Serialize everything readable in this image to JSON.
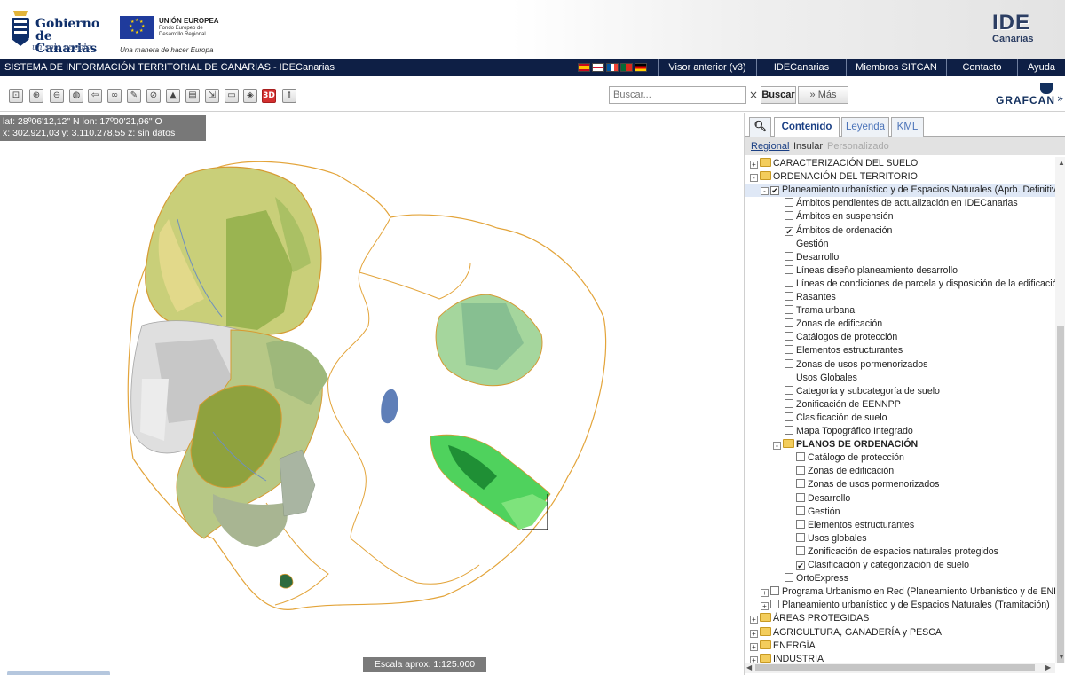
{
  "header": {
    "gobierno_name": "Gobierno de Canarias",
    "gobierno_slogan": "un solo pueblo",
    "eu_title": "UNIÓN EUROPEA",
    "eu_fund": "Fondo Europeo de Desarrollo Regional",
    "eu_motto": "Una manera de hacer Europa",
    "ide_logo": "IDE",
    "ide_logo_sub": "Canarias"
  },
  "navbar": {
    "title": "SISTEMA DE INFORMACIÓN TERRITORIAL DE CANARIAS - IDECanarias",
    "flags": [
      "es",
      "gb",
      "fr",
      "pt",
      "de"
    ],
    "links": [
      "Visor anterior (v3)",
      "IDECanarias",
      "Miembros SITCAN",
      "Contacto",
      "Ayuda"
    ]
  },
  "toolbar": {
    "tools": [
      "zoom-extent-icon",
      "zoom-in-icon",
      "zoom-out-icon",
      "globe-icon",
      "back-icon",
      "link-icon",
      "draw-icon",
      "measure-icon",
      "profile-icon",
      "print-icon",
      "export-icon",
      "swipe-icon",
      "layers-icon",
      "3d-icon",
      "info-icon"
    ],
    "label_3d": "3D",
    "search_placeholder": "Buscar...",
    "search_button": "Buscar",
    "more_button": "» Más",
    "grafcan": "GRAFCAN",
    "panel_toggle": "»"
  },
  "map": {
    "coords_line1": "lat: 28º06'12,12\" N  lon: 17º00'21,96\" O",
    "coords_line2": "x: 302.921,03  y: 3.110.278,55  z: sin datos",
    "scale": "Escala aprox. 1:125.000"
  },
  "panel": {
    "search_tab": "search-icon",
    "tabs": [
      "Contenido",
      "Leyenda",
      "KML"
    ],
    "subtabs": [
      "Regional",
      "Insular",
      "Personalizado"
    ],
    "tree": [
      {
        "label": "CARACTERIZACIÓN DEL SUELO",
        "level": 0,
        "expander": "+",
        "folder": true
      },
      {
        "label": "ORDENACIÓN DEL TERRITORIO",
        "level": 0,
        "expander": "-",
        "folder": true
      },
      {
        "label": "Planeamiento urbanístico y de Espacios Naturales (Aprb. Definitiva)",
        "level": 1,
        "expander": "-",
        "checked": true,
        "highlight": true
      },
      {
        "label": "Ámbitos pendientes de actualización en IDECanarias",
        "level": 2
      },
      {
        "label": "Ámbitos en suspensión",
        "level": 2
      },
      {
        "label": "Ámbitos de ordenación",
        "level": 2,
        "checked": true
      },
      {
        "label": "Gestión",
        "level": 2
      },
      {
        "label": "Desarrollo",
        "level": 2
      },
      {
        "label": "Líneas diseño planeamiento desarrollo",
        "level": 2
      },
      {
        "label": "Líneas de condiciones de parcela y disposición de la edificación",
        "level": 2
      },
      {
        "label": "Rasantes",
        "level": 2
      },
      {
        "label": "Trama urbana",
        "level": 2
      },
      {
        "label": "Zonas de edificación",
        "level": 2
      },
      {
        "label": "Catálogos de protección",
        "level": 2
      },
      {
        "label": "Elementos estructurantes",
        "level": 2
      },
      {
        "label": "Zonas de usos pormenorizados",
        "level": 2
      },
      {
        "label": "Usos Globales",
        "level": 2
      },
      {
        "label": "Categoría y subcategoría de suelo",
        "level": 2
      },
      {
        "label": "Zonificación de EENNPP",
        "level": 2
      },
      {
        "label": "Clasificación de suelo",
        "level": 2
      },
      {
        "label": "Mapa Topográfico Integrado",
        "level": 2
      },
      {
        "label": "PLANOS DE ORDENACIÓN",
        "level": 2,
        "expander": "-",
        "folder": true,
        "bold": true
      },
      {
        "label": "Catálogo de protección",
        "level": 3
      },
      {
        "label": "Zonas de edificación",
        "level": 3
      },
      {
        "label": "Zonas de usos pormenorizados",
        "level": 3
      },
      {
        "label": "Desarrollo",
        "level": 3
      },
      {
        "label": "Gestión",
        "level": 3
      },
      {
        "label": "Elementos estructurantes",
        "level": 3
      },
      {
        "label": "Usos globales",
        "level": 3
      },
      {
        "label": "Zonificación de espacios naturales protegidos",
        "level": 3
      },
      {
        "label": "Clasificación y categorización de suelo",
        "level": 3,
        "checked": true
      },
      {
        "label": "OrtoExpress",
        "level": 2
      },
      {
        "label": "Programa Urbanismo en Red (Planeamiento Urbanístico y de ENP)",
        "level": 1,
        "expander": "+"
      },
      {
        "label": "Planeamiento urbanístico y de Espacios Naturales (Tramitación)",
        "level": 1,
        "expander": "+"
      },
      {
        "label": "ÁREAS PROTEGIDAS",
        "level": 0,
        "expander": "+",
        "folder": true
      },
      {
        "label": "AGRICULTURA, GANADERÍA y PESCA",
        "level": 0,
        "expander": "+",
        "folder": true
      },
      {
        "label": "ENERGÍA",
        "level": 0,
        "expander": "+",
        "folder": true
      },
      {
        "label": "INDUSTRIA",
        "level": 0,
        "expander": "+",
        "folder": true
      }
    ]
  },
  "colors": {
    "navbar": "#0e1f45",
    "island_outline": "#e3a43a",
    "accent_blue": "#1a3f84"
  }
}
